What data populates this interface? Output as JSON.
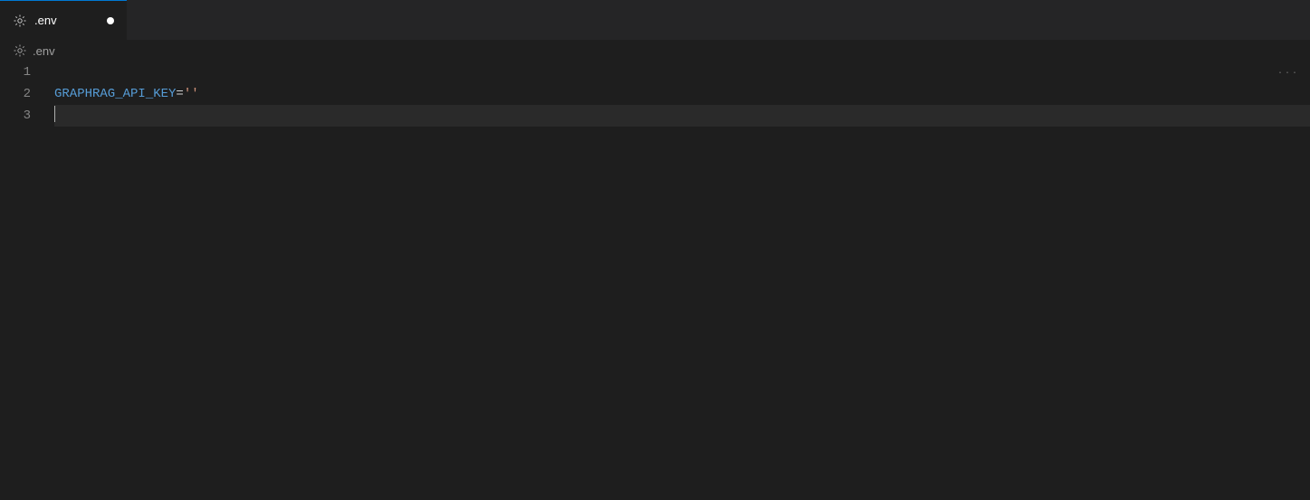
{
  "tab": {
    "label": ".env",
    "dirty": true
  },
  "breadcrumb": {
    "label": ".env"
  },
  "editor": {
    "lines": [
      {
        "no": "1",
        "key": "",
        "op": "",
        "str": "",
        "current": false
      },
      {
        "no": "2",
        "key": "GRAPHRAG_API_KEY",
        "op": "=",
        "str": "''",
        "current": false
      },
      {
        "no": "3",
        "key": "",
        "op": "",
        "str": "",
        "current": true
      }
    ]
  },
  "minimap": {
    "indicator": "···"
  }
}
